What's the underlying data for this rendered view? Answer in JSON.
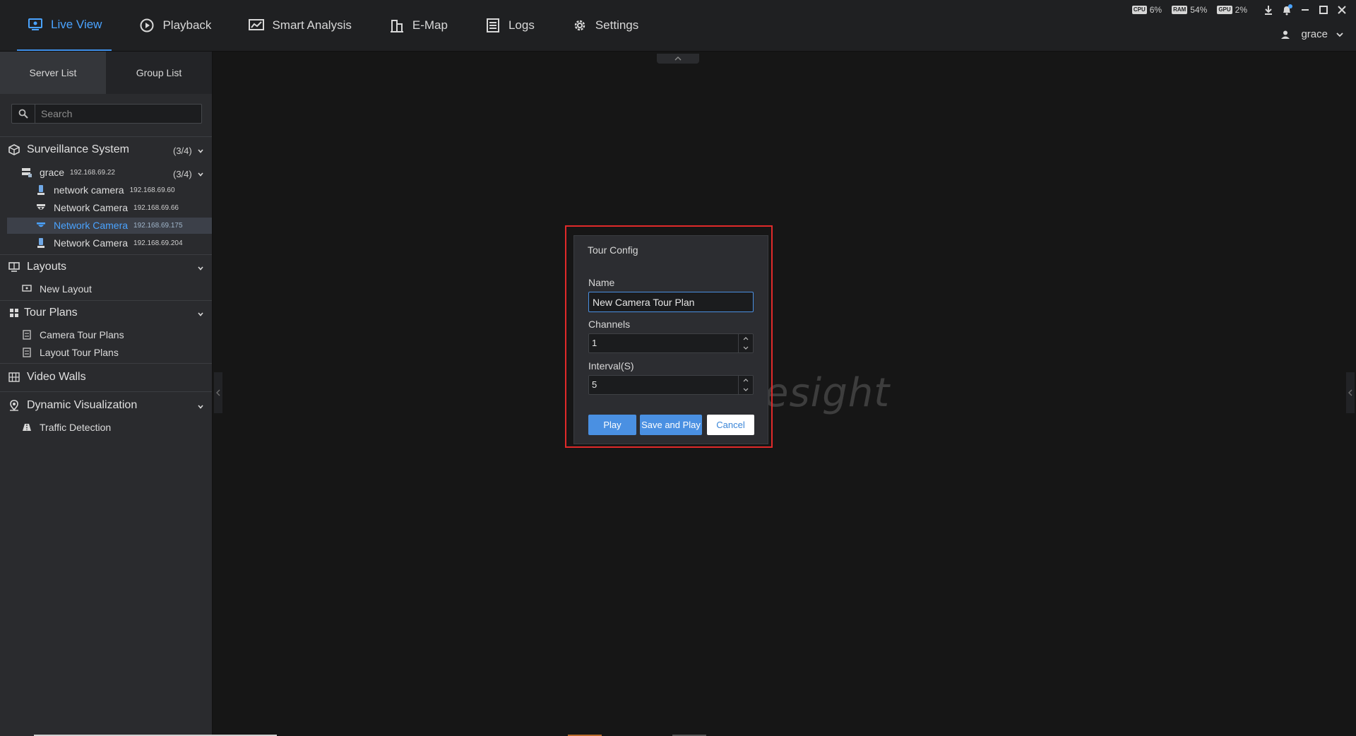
{
  "nav": {
    "items": [
      {
        "label": "Live View",
        "icon": "monitor-icon"
      },
      {
        "label": "Playback",
        "icon": "playback-icon"
      },
      {
        "label": "Smart Analysis",
        "icon": "chart-icon"
      },
      {
        "label": "E-Map",
        "icon": "map-icon"
      },
      {
        "label": "Logs",
        "icon": "logs-icon"
      },
      {
        "label": "Settings",
        "icon": "gear-icon"
      }
    ],
    "active": "Live View"
  },
  "system": {
    "cpu_chip": "CPU",
    "cpu": "6%",
    "ram_chip": "RAM",
    "ram": "54%",
    "gpu_chip": "GPU",
    "gpu": "2%"
  },
  "user": {
    "name": "grace"
  },
  "sidebar": {
    "tabs": [
      "Server List",
      "Group List"
    ],
    "search_placeholder": "Search",
    "surveillance": {
      "title": "Surveillance System",
      "count": "(3/4)"
    },
    "server": {
      "name": "grace",
      "ip": "192.168.69.22",
      "count": "(3/4)"
    },
    "cameras": [
      {
        "name": "network camera",
        "ip": "192.168.69.60"
      },
      {
        "name": "Network Camera",
        "ip": "192.168.69.66"
      },
      {
        "name": "Network Camera",
        "ip": "192.168.69.175"
      },
      {
        "name": "Network Camera",
        "ip": "192.168.69.204"
      }
    ],
    "layouts": {
      "title": "Layouts",
      "items": [
        "New Layout"
      ]
    },
    "tour_plans": {
      "title": "Tour Plans",
      "items": [
        "Camera Tour Plans",
        "Layout Tour Plans"
      ]
    },
    "video_walls": {
      "title": "Video Walls"
    },
    "dynamic": {
      "title": "Dynamic Visualization",
      "items": [
        "Traffic Detection"
      ]
    }
  },
  "main": {
    "watermark": "esight"
  },
  "dialog": {
    "title": "Tour Config",
    "name_label": "Name",
    "name_value": "New Camera Tour Plan",
    "channels_label": "Channels",
    "channels_value": "1",
    "interval_label": "Interval(S)",
    "interval_value": "5",
    "play": "Play",
    "save_and_play": "Save and Play",
    "cancel": "Cancel"
  },
  "colors": {
    "accent": "#4a90e2",
    "highlight": "#e02a2a",
    "background": "#161616"
  }
}
